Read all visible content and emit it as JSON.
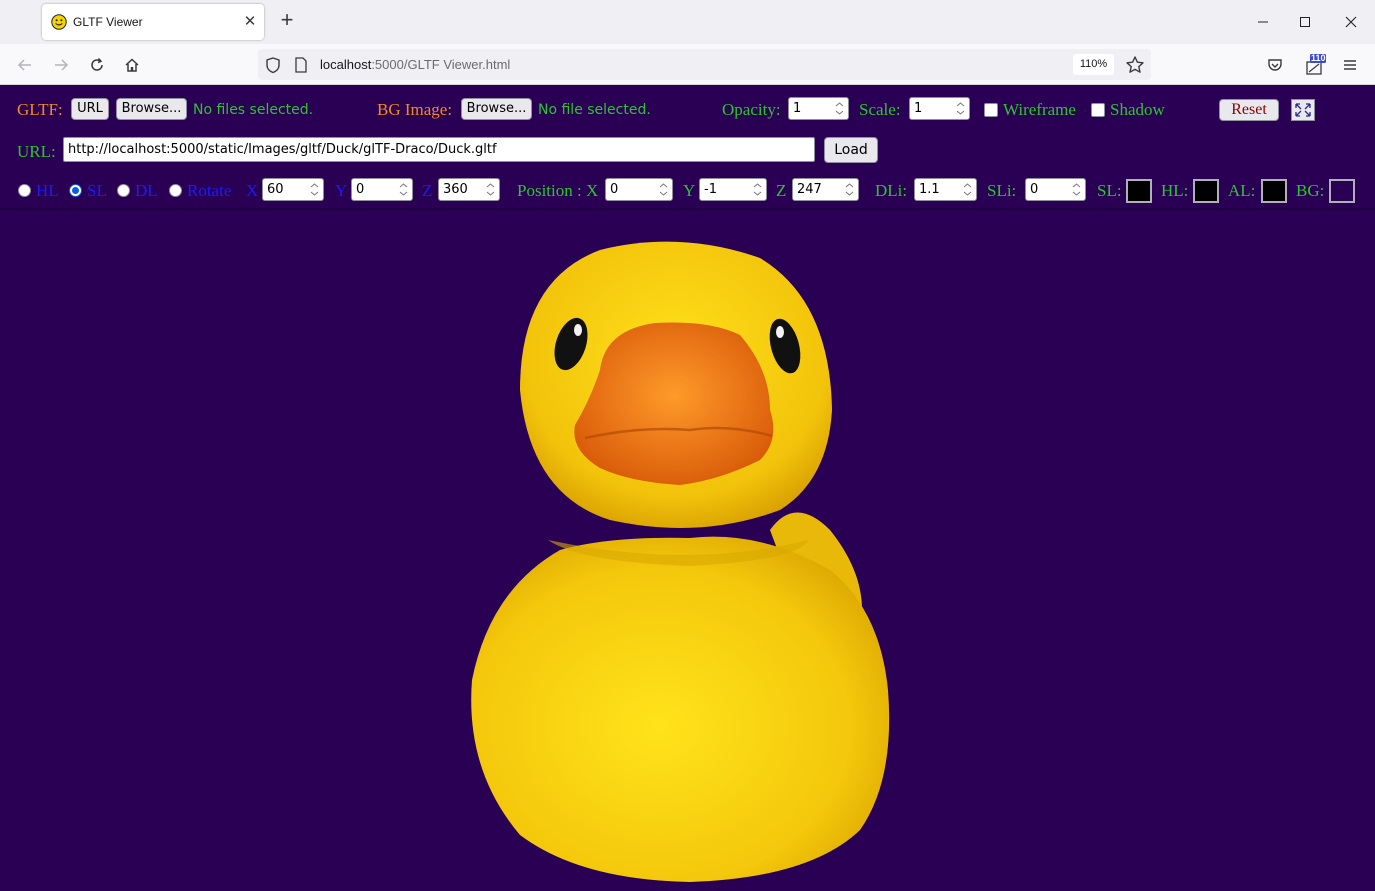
{
  "browser": {
    "tab_title": "GLTF Viewer",
    "url_host": "localhost",
    "url_rest": ":5000/GLTF Viewer.html",
    "zoom": "110%",
    "notification_count": "110"
  },
  "toolbar": {
    "gltf_label": "GLTF:",
    "url_button": "URL",
    "browse_button": "Browse...",
    "gltf_status": "No files selected.",
    "bg_label": "BG Image:",
    "bg_browse_button": "Browse...",
    "bg_status": "No file selected.",
    "opacity_label": "Opacity:",
    "opacity_value": "1",
    "scale_label": "Scale:",
    "scale_value": "1",
    "wireframe_label": "Wireframe",
    "shadow_label": "Shadow",
    "reset_button": "Reset"
  },
  "url_row": {
    "label": "URL:",
    "value": "http://localhost:5000/static/Images/gltf/Duck/glTF-Draco/Duck.gltf",
    "load_button": "Load"
  },
  "light_row": {
    "hl_label": "HL",
    "sl_label": "SL",
    "dl_label": "DL",
    "rotate_label": "Rotate",
    "selected": "SL",
    "x_label": "X",
    "x_value": "60",
    "y_label": "Y",
    "y_value": "0",
    "z_label": "Z",
    "z_value": "360",
    "position_label": "Position : X",
    "pos_x_value": "0",
    "pos_y_label": "Y",
    "pos_y_value": "-1",
    "pos_z_label": "Z",
    "pos_z_value": "247",
    "dli_label": "DLi:",
    "dli_value": "1.1",
    "sli_label": "SLi:",
    "sli_value": "0",
    "sl_color_label": "SL:",
    "hl_color_label": "HL:",
    "al_color_label": "AL:",
    "bg_color_label": "BG:"
  },
  "colors": {
    "page_bg": "#2a0055",
    "label_orange": "#f08a24",
    "label_green": "#2ec42e",
    "label_blue": "#1a1aff",
    "duck_yellow": "#f7d312",
    "beak_orange": "#f07a12"
  },
  "icons": {
    "favicon": "smiley-icon",
    "fullscreen": "expand-icon"
  }
}
